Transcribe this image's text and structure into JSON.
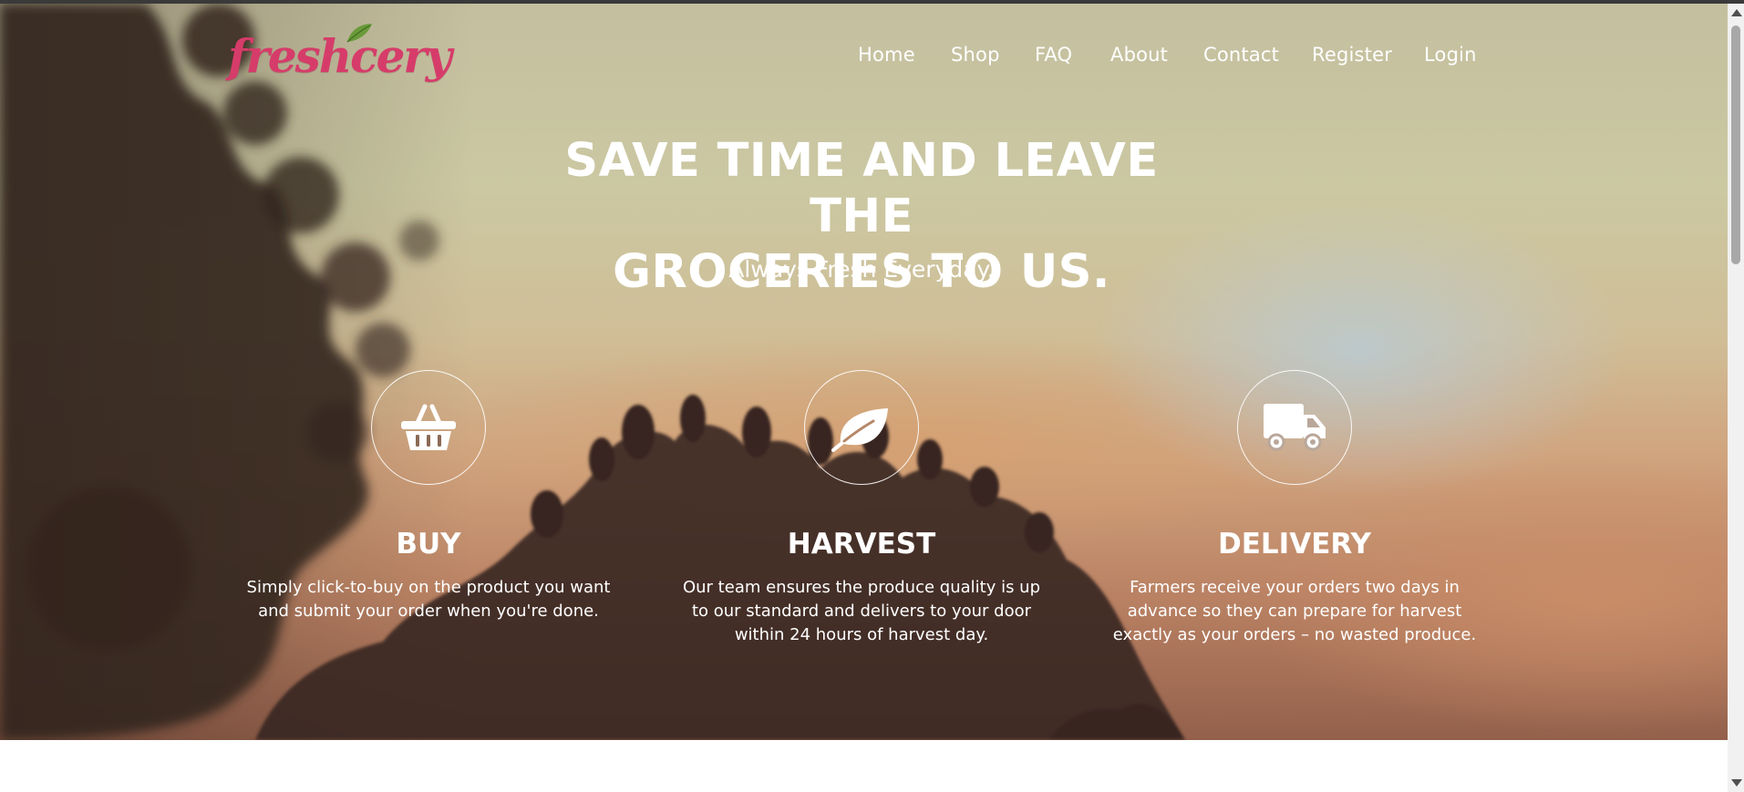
{
  "brand": {
    "logo_text": "freshcery",
    "logo_color": "#d63c6a",
    "leaf_color": "#6a9a3a"
  },
  "nav": {
    "items": [
      {
        "label": "Home"
      },
      {
        "label": "Shop"
      },
      {
        "label": "FAQ"
      },
      {
        "label": "About"
      },
      {
        "label": "Contact"
      },
      {
        "label": "Register"
      },
      {
        "label": "Login"
      }
    ]
  },
  "hero": {
    "headline_line1": "SAVE TIME AND LEAVE THE",
    "headline_line2": "GROCERIES TO US.",
    "subheadline": "Always Fresh Everyday."
  },
  "features": [
    {
      "icon": "basket-icon",
      "title": "BUY",
      "description": "Simply click-to-buy on the product you want and submit your order when you're done."
    },
    {
      "icon": "leaf-icon",
      "title": "HARVEST",
      "description": "Our team ensures the produce quality is up to our standard and delivers to your door within 24 hours of harvest day."
    },
    {
      "icon": "truck-icon",
      "title": "DELIVERY",
      "description": "Farmers receive your orders two days in advance so they can prepare for harvest exactly as your orders – no wasted produce."
    }
  ]
}
